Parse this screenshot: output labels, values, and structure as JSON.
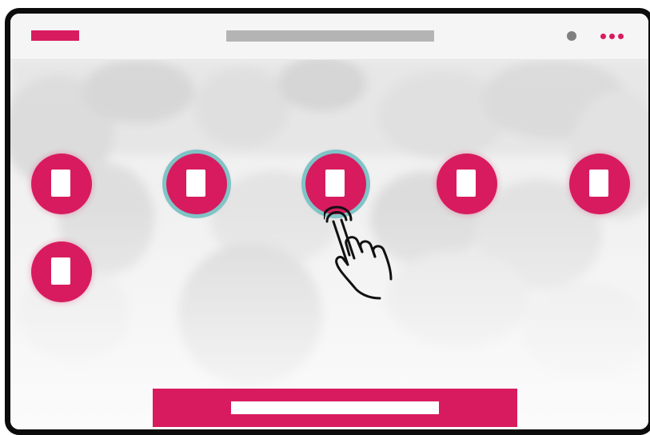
{
  "window": {
    "topbar": {
      "logo_color": "#d81b5f",
      "title_placeholder_color": "#b4b4b4",
      "status_icon": "status-dot-icon",
      "menu_icon": "more-horizontal-icon"
    },
    "background": {
      "description_icon": "faded-photo"
    },
    "items": [
      {
        "id": "item-1",
        "selected": false,
        "icon": "document-icon"
      },
      {
        "id": "item-2",
        "selected": true,
        "icon": "document-icon"
      },
      {
        "id": "item-3",
        "selected": true,
        "icon": "document-icon"
      },
      {
        "id": "item-4",
        "selected": false,
        "icon": "document-icon"
      },
      {
        "id": "item-5",
        "selected": false,
        "icon": "document-icon"
      },
      {
        "id": "item-6",
        "selected": false,
        "icon": "document-icon"
      }
    ],
    "pointer": {
      "icon": "tap-hand-icon"
    },
    "primary_action": {
      "icon": "label-placeholder"
    },
    "colors": {
      "accent": "#d81b5f",
      "selection_ring": "#7fc4c6",
      "frame": "#0c0c0c"
    }
  }
}
